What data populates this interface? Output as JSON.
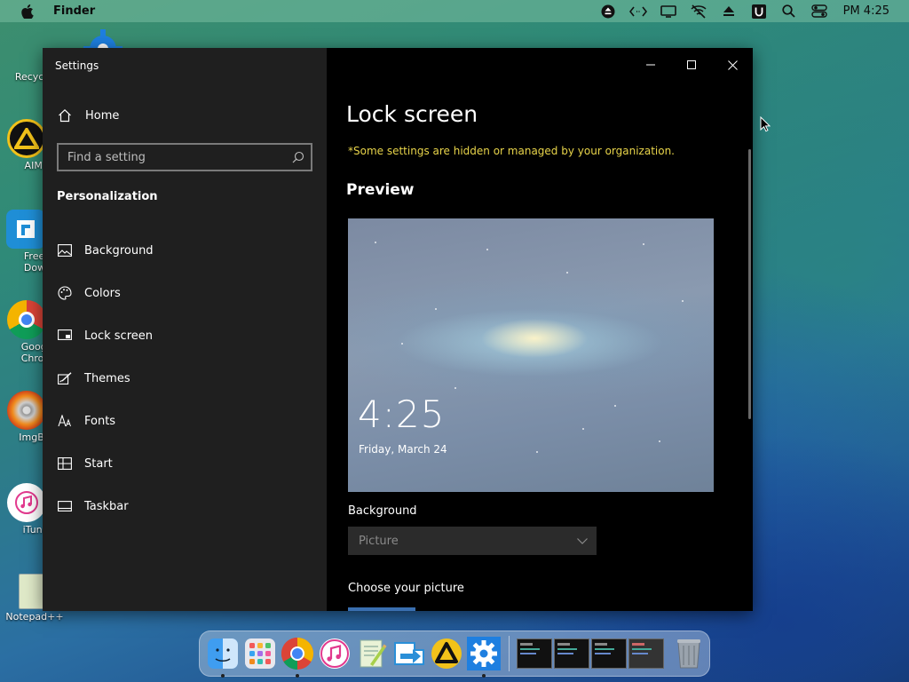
{
  "menubar": {
    "app_name": "Finder",
    "clock": "PM 4:25",
    "icons": [
      "eject-circle-icon",
      "code-arrows-icon",
      "display-icon",
      "wifi-off-icon",
      "eject-icon",
      "u-badge-icon",
      "search-icon",
      "control-center-icon"
    ]
  },
  "desktop": {
    "icons": [
      {
        "label": "Recycle",
        "icon": "recycle-bin-icon"
      },
      {
        "label": "AIMP",
        "icon": "aimp-icon"
      },
      {
        "label": "Free\nDownl",
        "icon": "free-download-manager-icon"
      },
      {
        "label": "Goog\nChron",
        "icon": "google-chrome-icon"
      },
      {
        "label": "ImgBu",
        "icon": "imgburn-icon"
      },
      {
        "label": "iTune",
        "icon": "itunes-icon"
      },
      {
        "label": "Notepad++",
        "icon": "notepadpp-icon"
      }
    ]
  },
  "window": {
    "title": "Settings",
    "sidebar": {
      "home_label": "Home",
      "search_placeholder": "Find a setting",
      "section_title": "Personalization",
      "items": [
        {
          "label": "Background",
          "icon": "picture-icon"
        },
        {
          "label": "Colors",
          "icon": "palette-icon"
        },
        {
          "label": "Lock screen",
          "icon": "lock-screen-icon"
        },
        {
          "label": "Themes",
          "icon": "themes-icon"
        },
        {
          "label": "Fonts",
          "icon": "fonts-icon"
        },
        {
          "label": "Start",
          "icon": "start-icon"
        },
        {
          "label": "Taskbar",
          "icon": "taskbar-icon"
        }
      ]
    },
    "main": {
      "title": "Lock screen",
      "org_note": "*Some settings are hidden or managed by your organization.",
      "preview_heading": "Preview",
      "preview_time": "4:25",
      "preview_date": "Friday, March 24",
      "background_label": "Background",
      "background_value": "Picture",
      "choose_label": "Choose your picture"
    },
    "colors": {
      "note": "#e8d44a",
      "sidebar": "#1f1f1f",
      "main": "#000000"
    }
  },
  "dock": {
    "apps": [
      "finder-icon",
      "launchpad-icon",
      "chrome-icon",
      "itunes-icon",
      "notepadpp-icon",
      "free-download-manager-icon",
      "aimp-icon",
      "settings-gear-icon"
    ],
    "running": [
      "finder-icon",
      "chrome-icon",
      "settings-gear-icon"
    ]
  }
}
